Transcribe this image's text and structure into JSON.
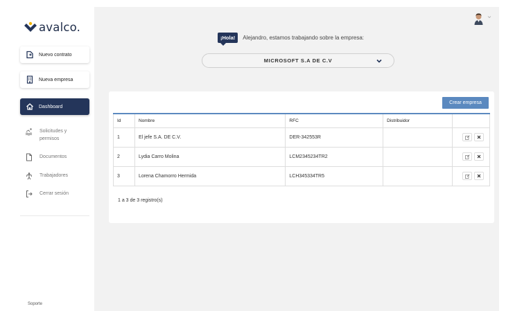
{
  "brand": {
    "name": "avalco.",
    "accent": "#24355a"
  },
  "sidebar": {
    "new_contract": "Nuevo contrato",
    "new_company": "Nueva empresa",
    "dashboard": "Dashboard",
    "nav": [
      {
        "label": "Solicitudes y permisos",
        "icon": "swimmer-icon"
      },
      {
        "label": "Documentos",
        "icon": "document-icon"
      },
      {
        "label": "Trabajadores",
        "icon": "worker-icon"
      },
      {
        "label": "Cerrar sesión",
        "icon": "logout-icon"
      }
    ],
    "support": "Soporte"
  },
  "header": {
    "greeting_badge": "¡Hola!",
    "greeting_text": "Alejandro, estamos trabajando sobre la empresa:",
    "company": "MICROSOFT S.A DE C.V"
  },
  "table": {
    "create_button": "Crear empresa",
    "columns": [
      "Id",
      "Nombre",
      "RFC",
      "Distribuidor",
      ""
    ],
    "rows": [
      {
        "id": "1",
        "nombre": "El jefe S.A. DE C.V.",
        "rfc": "DER-342553R",
        "distribuidor": ""
      },
      {
        "id": "2",
        "nombre": "Lydia Carro Molina",
        "rfc": "LCM2345234TR2",
        "distribuidor": ""
      },
      {
        "id": "3",
        "nombre": "Lorena Chamorro Hermida",
        "rfc": "LCH345334TR5",
        "distribuidor": ""
      }
    ],
    "summary": "1 a 3 de 3 registro(s)"
  },
  "colors": {
    "primary": "#24355a",
    "button_blue": "#5b89bf",
    "background": "#f2f2f2"
  }
}
